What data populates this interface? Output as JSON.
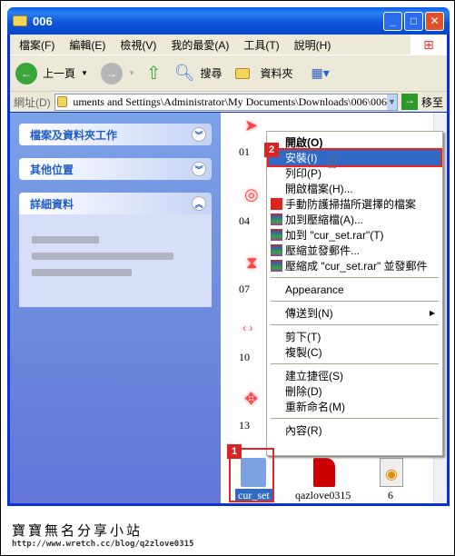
{
  "window": {
    "title": "006"
  },
  "menubar": [
    "檔案(F)",
    "編輯(E)",
    "檢視(V)",
    "我的最愛(A)",
    "工具(T)",
    "說明(H)"
  ],
  "toolbar": {
    "back": "上一頁",
    "search": "搜尋",
    "folders": "資料夾"
  },
  "address": {
    "label": "網址(D)",
    "value": "uments and Settings\\Administrator\\My Documents\\Downloads\\006\\006",
    "go": "移至"
  },
  "left_panels": [
    {
      "title": "檔案及資料夾工作",
      "chevron": "down"
    },
    {
      "title": "其他位置",
      "chevron": "down"
    },
    {
      "title": "詳細資料",
      "chevron": "up"
    }
  ],
  "files": [
    {
      "label": "01"
    },
    {
      "label": "04"
    },
    {
      "label": "07"
    },
    {
      "label": "10"
    },
    {
      "label": "13"
    },
    {
      "label": "cur_set",
      "selected": true
    },
    {
      "label": "qazlove0315"
    },
    {
      "label": "6"
    }
  ],
  "context_menu": {
    "items": [
      {
        "label": "開啟(O)",
        "bold": true
      },
      {
        "label": "安裝(I)",
        "selected": true
      },
      {
        "label": "列印(P)"
      },
      {
        "label": "開啟檔案(H)..."
      },
      {
        "label": "手動防護掃描所選擇的檔案",
        "icon": "antivirus-icon"
      },
      {
        "label": "加到壓縮檔(A)...",
        "icon": "winrar-icon"
      },
      {
        "label": "加到 \"cur_set.rar\"(T)",
        "icon": "winrar-icon"
      },
      {
        "label": "壓縮並發郵件...",
        "icon": "winrar-icon"
      },
      {
        "label": "壓縮成 \"cur_set.rar\" 並發郵件",
        "icon": "winrar-icon"
      },
      {
        "sep": true
      },
      {
        "label": "Appearance"
      },
      {
        "sep": true
      },
      {
        "label": "傳送到(N)",
        "submenu": true
      },
      {
        "sep": true
      },
      {
        "label": "剪下(T)"
      },
      {
        "label": "複製(C)"
      },
      {
        "sep": true
      },
      {
        "label": "建立捷徑(S)"
      },
      {
        "label": "刪除(D)"
      },
      {
        "label": "重新命名(M)"
      },
      {
        "sep": true
      },
      {
        "label": "內容(R)"
      }
    ]
  },
  "steps": [
    "1",
    "2"
  ],
  "watermark": {
    "title": "寶寶無名分享小站",
    "url": "http://www.wretch.cc/blog/q2zlove0315"
  },
  "colors": {
    "accent": "#316ac5",
    "highlight": "#dd2222"
  }
}
